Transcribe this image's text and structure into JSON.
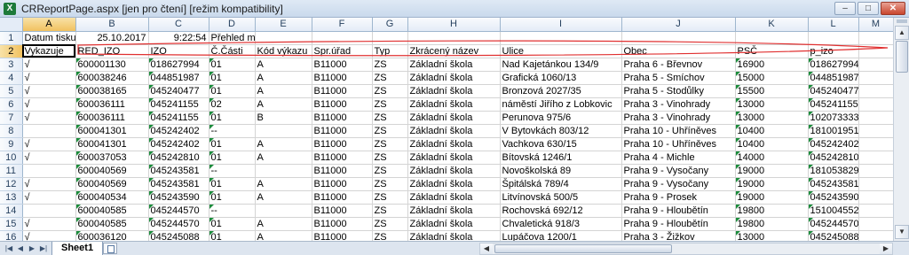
{
  "window": {
    "title": "CRReportPage.aspx  [jen pro čtení]  [režim kompatibility]",
    "app_icon": "X",
    "minimize": "–",
    "maximize": "□",
    "close": "✕"
  },
  "columns": [
    "A",
    "B",
    "C",
    "D",
    "E",
    "F",
    "G",
    "H",
    "I",
    "J",
    "K",
    "L",
    "M"
  ],
  "rows": [
    {
      "num": "1",
      "cells": [
        "Datum tisku",
        "25.10.2017",
        "9:22:54",
        "Přehled míst výuky",
        "",
        "",
        "",
        "",
        "",
        "",
        "",
        "",
        ""
      ]
    },
    {
      "num": "2",
      "cells": [
        "Vykazuje",
        "RED_IZO",
        "IZO",
        "Č.Části",
        "Kód výkazu",
        "Spr.úřad",
        "Typ",
        "Zkrácený název",
        "Ulice",
        "Obec",
        "PSČ",
        "p_izo",
        ""
      ]
    },
    {
      "num": "3",
      "cells": [
        "√",
        "600001130",
        "018627994",
        "01",
        "A",
        "B11000",
        "ZS",
        "Základní škola",
        "Nad Kajetánkou 134/9",
        "Praha 6 - Břevnov",
        "16900",
        "018627994",
        ""
      ]
    },
    {
      "num": "4",
      "cells": [
        "√",
        "600038246",
        "044851987",
        "01",
        "A",
        "B11000",
        "ZS",
        "Základní škola",
        "Grafická 1060/13",
        "Praha 5 - Smíchov",
        "15000",
        "044851987",
        ""
      ]
    },
    {
      "num": "5",
      "cells": [
        "√",
        "600038165",
        "045240477",
        "01",
        "A",
        "B11000",
        "ZS",
        "Základní škola",
        "Bronzová 2027/35",
        "Praha 5 - Stodůlky",
        "15500",
        "045240477",
        ""
      ]
    },
    {
      "num": "6",
      "cells": [
        "√",
        "600036111",
        "045241155",
        "02",
        "A",
        "B11000",
        "ZS",
        "Základní škola",
        "náměstí Jiřího z Lobkovic",
        "Praha 3 - Vinohrady",
        "13000",
        "045241155",
        ""
      ]
    },
    {
      "num": "7",
      "cells": [
        "√",
        "600036111",
        "045241155",
        "01",
        "B",
        "B11000",
        "ZS",
        "Základní škola",
        "Perunova 975/6",
        "Praha 3 - Vinohrady",
        "13000",
        "102073333",
        ""
      ]
    },
    {
      "num": "8",
      "cells": [
        "",
        "600041301",
        "045242402",
        "--",
        "",
        "B11000",
        "ZS",
        "Základní škola",
        "V Bytovkách 803/12",
        "Praha 10 - Uhříněves",
        "10400",
        "181001951",
        ""
      ]
    },
    {
      "num": "9",
      "cells": [
        "√",
        "600041301",
        "045242402",
        "01",
        "A",
        "B11000",
        "ZS",
        "Základní škola",
        "Vachkova 630/15",
        "Praha 10 - Uhříněves",
        "10400",
        "045242402",
        ""
      ]
    },
    {
      "num": "10",
      "cells": [
        "√",
        "600037053",
        "045242810",
        "01",
        "A",
        "B11000",
        "ZS",
        "Základní škola",
        "Bítovská 1246/1",
        "Praha 4 - Michle",
        "14000",
        "045242810",
        ""
      ]
    },
    {
      "num": "11",
      "cells": [
        "",
        "600040569",
        "045243581",
        "--",
        "",
        "B11000",
        "ZS",
        "Základní škola",
        "Novoškolská 89",
        "Praha 9 - Vysočany",
        "19000",
        "181053829",
        ""
      ]
    },
    {
      "num": "12",
      "cells": [
        "√",
        "600040569",
        "045243581",
        "01",
        "A",
        "B11000",
        "ZS",
        "Základní škola",
        "Špitálská 789/4",
        "Praha 9 - Vysočany",
        "19000",
        "045243581",
        ""
      ]
    },
    {
      "num": "13",
      "cells": [
        "√",
        "600040534",
        "045243590",
        "01",
        "A",
        "B11000",
        "ZS",
        "Základní škola",
        "Litvínovská 500/5",
        "Praha 9 - Prosek",
        "19000",
        "045243590",
        ""
      ]
    },
    {
      "num": "14",
      "cells": [
        "",
        "600040585",
        "045244570",
        "--",
        "",
        "B11000",
        "ZS",
        "Základní škola",
        "Rochovská 692/12",
        "Praha 9 - Hloubětín",
        "19800",
        "151004552",
        ""
      ]
    },
    {
      "num": "15",
      "cells": [
        "√",
        "600040585",
        "045244570",
        "01",
        "A",
        "B11000",
        "ZS",
        "Základní škola",
        "Chvaletická 918/3",
        "Praha 9 - Hloubětín",
        "19800",
        "045244570",
        ""
      ]
    },
    {
      "num": "16",
      "cells": [
        "√",
        "600036120",
        "045245088",
        "01",
        "A",
        "B11000",
        "ZS",
        "Základní škola",
        "Lupáčova 1200/1",
        "Praha 3 - Žižkov",
        "13000",
        "045245088",
        ""
      ]
    }
  ],
  "sheet_tabs": [
    "Sheet1"
  ],
  "colors": {
    "annotation": "#e03030",
    "flag": "#1c8c3c",
    "selection": "#f1c15f"
  }
}
